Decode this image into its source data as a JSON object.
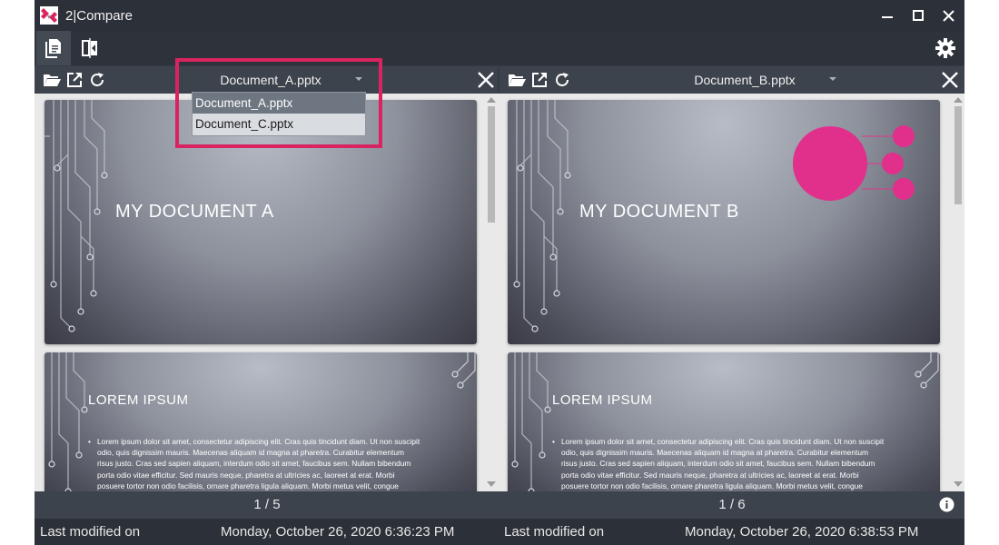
{
  "app": {
    "title": "2|Compare",
    "accent": "#d9245f"
  },
  "toolbar": {
    "tabs": [
      {
        "icon": "documents-icon",
        "active": true
      },
      {
        "icon": "compare-icon",
        "active": false
      }
    ],
    "settings_icon": "gear-icon"
  },
  "left_panel": {
    "selected_file": "Document_A.pptx",
    "dropdown_options": [
      "Document_A.pptx",
      "Document_C.pptx"
    ],
    "slides": [
      {
        "title": "MY DOCUMENT A"
      },
      {
        "title": "LOREM IPSUM",
        "body": [
          "Lorem ipsum dolor sit amet, consectetur adipiscing elit. Cras quis tincidunt diam. Ut non suscipit",
          "odio, quis dignissim mauris. Maecenas aliquam id magna at pharetra. Curabitur elementum",
          "risus justo. Cras sed sapien aliquam, interdum odio sit amet, faucibus sem. Nullam bibendum",
          "porta odio vitae efficitur. Sed mauris neque, pharetra at ultricies ac, laoreet at erat. Morbi",
          "posuere tortor non odio facilisis, ornare pharetra ligula aliquam. Morbi metus velit, congue"
        ]
      }
    ],
    "page": "1 / 5",
    "status_label": "Last modified on",
    "status_value": "Monday, October 26, 2020 6:36:23 PM"
  },
  "right_panel": {
    "selected_file": "Document_B.pptx",
    "slides": [
      {
        "title": "MY DOCUMENT B"
      },
      {
        "title": "LOREM IPSUM",
        "body": [
          "Lorem ipsum dolor sit amet, consectetur adipiscing elit. Cras quis tincidunt diam. Ut non suscipit",
          "odio, quis dignissim mauris. Maecenas aliquam id magna at pharetra. Curabitur elementum",
          "risus justo. Cras sed sapien aliquam, interdum odio sit amet, faucibus sem. Nullam bibendum",
          "porta odio vitae efficitur. Sed mauris neque, pharetra at ultricies ac, laoreet at erat. Morbi",
          "posuere tortor non odio facilisis, ornare pharetra ligula aliquam. Morbi metus velit, congue"
        ]
      }
    ],
    "page": "1 / 6",
    "status_label": "Last modified on",
    "status_value": "Monday, October 26, 2020 6:38:53 PM",
    "info_icon": "info-icon"
  }
}
